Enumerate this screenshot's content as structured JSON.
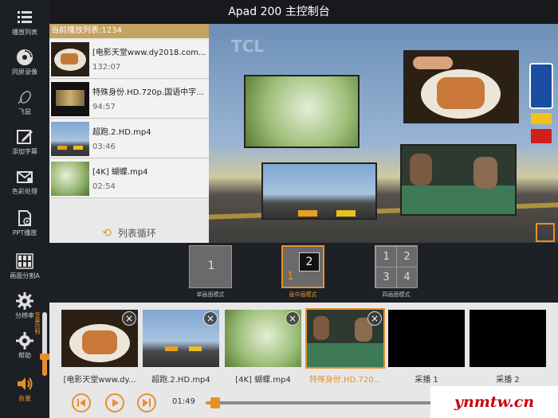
{
  "window": {
    "title": "Apad 200 主控制台"
  },
  "sidebar": {
    "items": [
      {
        "label": "播放列表",
        "icon": "list-icon"
      },
      {
        "label": "同屏录像",
        "icon": "disc-icon"
      },
      {
        "label": "飞鼠",
        "icon": "mouse-icon"
      },
      {
        "label": "添加字幕",
        "icon": "edit-icon"
      },
      {
        "label": "色彩处理",
        "icon": "mail-icon"
      },
      {
        "label": "PPT播放",
        "icon": "ppt-icon"
      },
      {
        "label": "画面分割A",
        "icon": "grid-icon"
      },
      {
        "label": "分辨率",
        "icon": "gear-icon"
      },
      {
        "label": "帮助",
        "icon": "help-icon"
      },
      {
        "label": "音量",
        "icon": "volume-icon"
      }
    ],
    "volume_slider": {
      "label": "音量控制",
      "level": 0.3
    }
  },
  "playlist": {
    "header": "当前播放列表:1234",
    "items": [
      {
        "title": "[电影天堂www.dy2018.com...",
        "duration": "132:07"
      },
      {
        "title": "特殊身份.HD.720p.国语中字...",
        "duration": "94:57"
      },
      {
        "title": "超跑.2.HD.mp4",
        "duration": "03:46"
      },
      {
        "title": "[4K] 蝴蝶.mp4",
        "duration": "02:54"
      }
    ],
    "loop_label": "列表循环"
  },
  "preview": {
    "overlay_text": "TCL"
  },
  "modes": [
    {
      "label": "单画面模式",
      "cells": [
        "1"
      ]
    },
    {
      "label": "画中画模式",
      "cells": [
        "2",
        "1"
      ],
      "active": true
    },
    {
      "label": "四画面模式",
      "cells": [
        "1",
        "2",
        "3",
        "4"
      ]
    }
  ],
  "sources": [
    {
      "label": "[电影天堂www.dy...",
      "closable": true
    },
    {
      "label": "超跑.2.HD.mp4",
      "closable": true
    },
    {
      "label": "[4K] 蝴蝶.mp4",
      "closable": true
    },
    {
      "label": "特殊身份.HD.720...",
      "closable": true,
      "selected": true
    },
    {
      "label": "采播 1",
      "closable": false
    },
    {
      "label": "采播 2",
      "closable": false
    }
  ],
  "playback": {
    "time": "01:49",
    "progress": 0.02
  },
  "watermark": "ynmtw.cn",
  "colors": {
    "accent": "#e8902c",
    "header": "#c4a261",
    "sidebar": "#1c1f24"
  }
}
